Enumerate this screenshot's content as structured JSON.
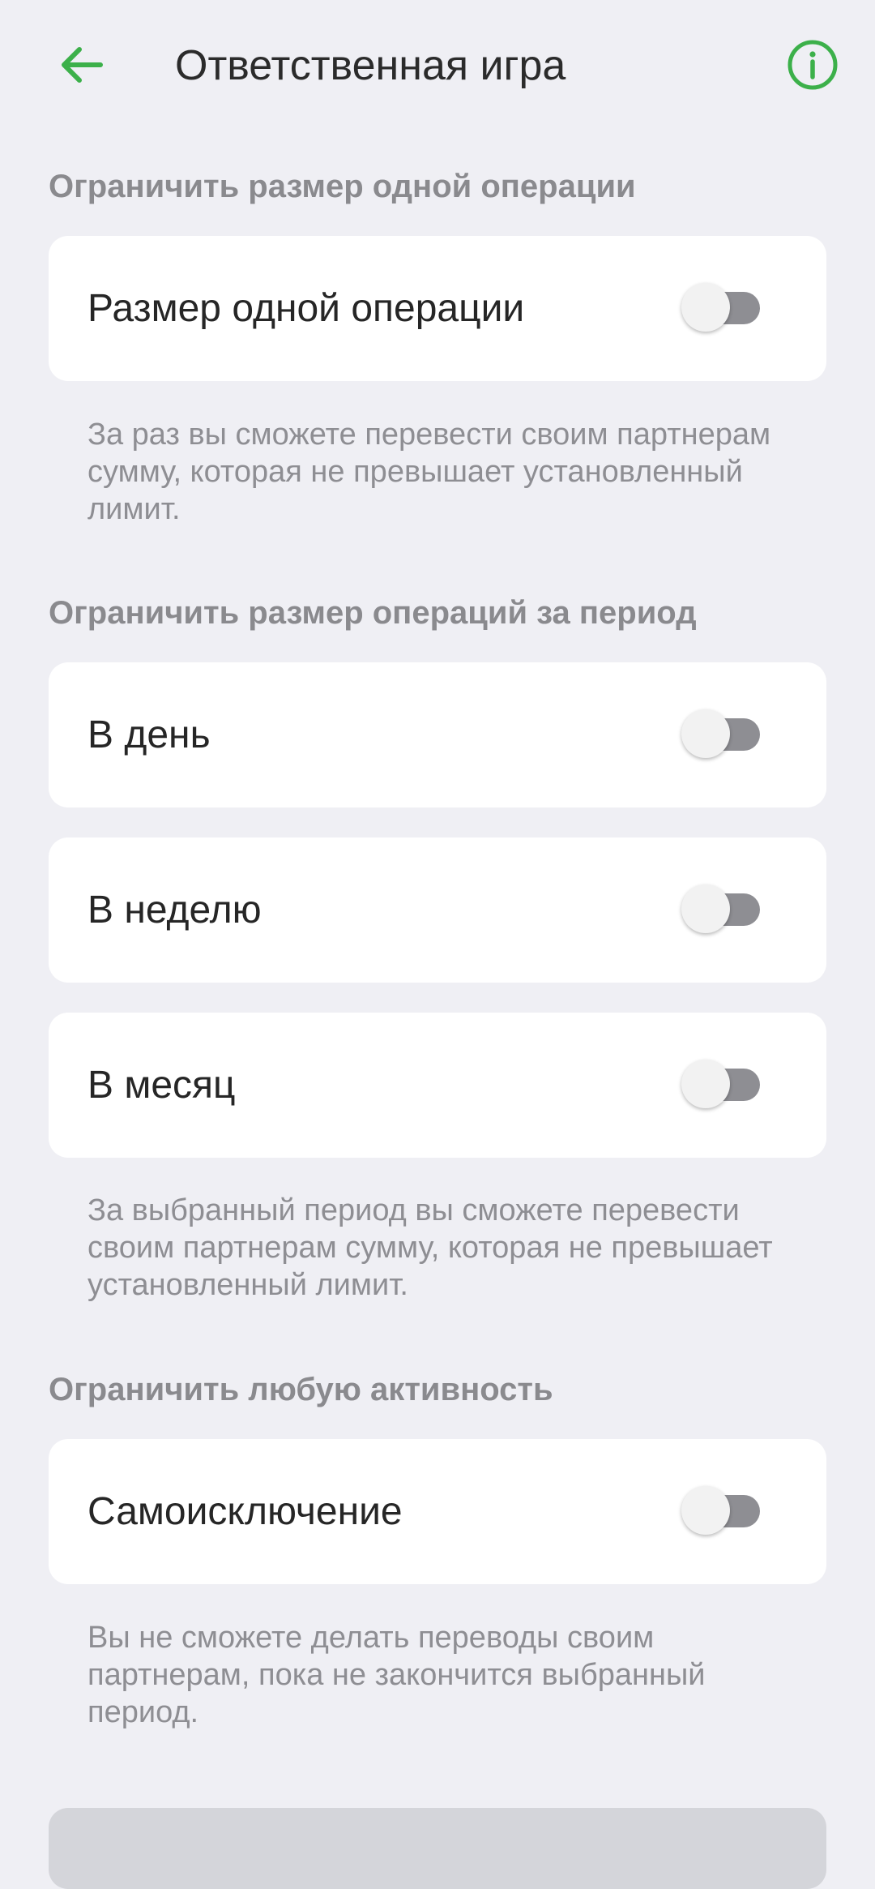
{
  "header": {
    "title": "Ответственная игра",
    "back_icon": "arrow-left-icon",
    "info_icon": "info-circle-icon",
    "accent_color": "#3cb04a"
  },
  "sections": [
    {
      "title": "Ограничить размер одной операции",
      "items": [
        {
          "label": "Размер одной операции",
          "enabled": false
        }
      ],
      "hint": "За раз вы сможете перевести своим партнерам сумму, которая не превышает установленный лимит."
    },
    {
      "title": "Ограничить размер операций за период",
      "items": [
        {
          "label": "В день",
          "enabled": false
        },
        {
          "label": "В неделю",
          "enabled": false
        },
        {
          "label": "В месяц",
          "enabled": false
        }
      ],
      "hint": "За выбранный период вы сможете перевести своим партнерам сумму, которая не превышает установленный лимит."
    },
    {
      "title": "Ограничить любую активность",
      "items": [
        {
          "label": "Самоисключение",
          "enabled": false
        }
      ],
      "hint": "Вы не сможете делать переводы своим партнерам, пока не закончится выбранный период."
    }
  ]
}
